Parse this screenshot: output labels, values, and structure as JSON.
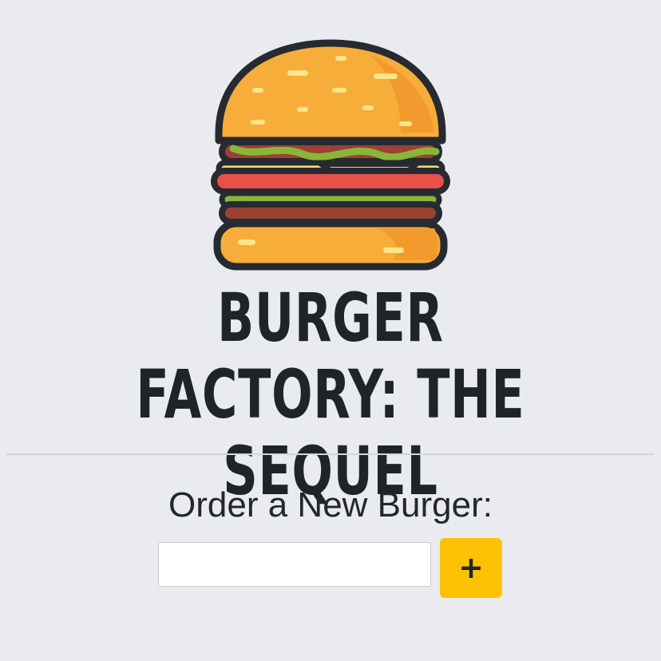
{
  "header": {
    "title": "BURGER FACTORY: THE SEQUEL",
    "logo_icon": "burger-icon"
  },
  "order_form": {
    "label": "Order a New Burger:",
    "input_value": "",
    "input_placeholder": "",
    "add_button_label": "+",
    "add_button_color": "#fcc203"
  },
  "colors": {
    "background": "#e9ebef",
    "title_text": "#1f242b"
  }
}
